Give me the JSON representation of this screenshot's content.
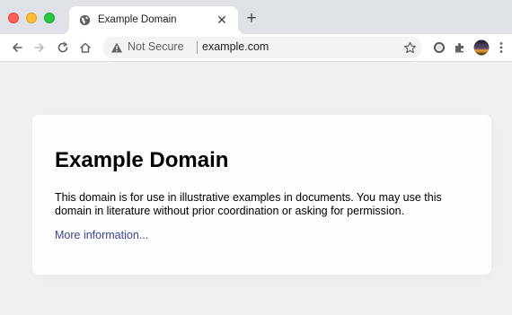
{
  "browser": {
    "tab": {
      "title": "Example Domain",
      "favicon": "globe-icon",
      "close_glyph": "✕"
    },
    "new_tab_glyph": "+",
    "toolbar": {
      "back_icon": "back-arrow-icon",
      "forward_icon": "forward-arrow-icon",
      "reload_icon": "reload-icon",
      "home_icon": "home-icon"
    },
    "omnibox": {
      "security_label": "Not Secure",
      "url": "example.com",
      "warning_icon": "warning-icon",
      "bookmark_icon": "star-icon"
    },
    "extensions": [
      "circle-extension-icon",
      "puzzle-icon",
      "profile-avatar",
      "kebab-menu-icon"
    ]
  },
  "page": {
    "heading": "Example Domain",
    "description": "This domain is for use in illustrative examples in documents. You may use this domain in literature without prior coordination or asking for permission.",
    "link_text": "More information...",
    "colors": {
      "background": "#f0f0f2",
      "card": "#fdfdff",
      "link": "#38488f"
    }
  }
}
